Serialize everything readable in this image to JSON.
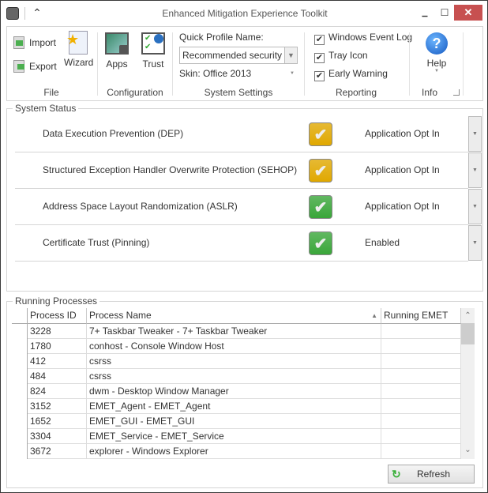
{
  "window": {
    "title": "Enhanced Mitigation Experience Toolkit",
    "close": "✕",
    "minimize": "▁",
    "maximize": "☐",
    "collapse": "⌃"
  },
  "ribbon": {
    "file": {
      "import": "Import",
      "export": "Export",
      "wizard": "Wizard",
      "label": "File"
    },
    "configuration": {
      "apps": "Apps",
      "trust": "Trust",
      "label": "Configuration"
    },
    "system_settings": {
      "profile_label": "Quick Profile Name:",
      "profile_value": "Recommended security ...",
      "skin": "Skin: Office 2013",
      "label": "System Settings"
    },
    "reporting": {
      "items": [
        {
          "label": "Windows Event Log",
          "checked": true
        },
        {
          "label": "Tray Icon",
          "checked": true
        },
        {
          "label": "Early Warning",
          "checked": true
        }
      ],
      "label": "Reporting"
    },
    "info": {
      "help": "Help",
      "label": "Info"
    }
  },
  "system_status": {
    "title": "System Status",
    "rows": [
      {
        "label": "Data Execution Prevention (DEP)",
        "status": "Application Opt In",
        "color": "#e0a800"
      },
      {
        "label": "Structured Exception Handler Overwrite Protection (SEHOP)",
        "status": "Application Opt In",
        "color": "#e0a800"
      },
      {
        "label": "Address Space Layout Randomization (ASLR)",
        "status": "Application Opt In",
        "color": "#3aa63a"
      },
      {
        "label": "Certificate Trust (Pinning)",
        "status": "Enabled",
        "color": "#3aa63a"
      }
    ]
  },
  "processes": {
    "title": "Running Processes",
    "columns": [
      "Process ID",
      "Process Name",
      "Running EMET"
    ],
    "rows": [
      [
        "3228",
        "7+ Taskbar Tweaker - 7+ Taskbar Tweaker",
        ""
      ],
      [
        "1780",
        "conhost - Console Window Host",
        ""
      ],
      [
        "412",
        "csrss",
        ""
      ],
      [
        "484",
        "csrss",
        ""
      ],
      [
        "824",
        "dwm - Desktop Window Manager",
        ""
      ],
      [
        "3152",
        "EMET_Agent - EMET_Agent",
        ""
      ],
      [
        "1652",
        "EMET_GUI - EMET_GUI",
        ""
      ],
      [
        "3304",
        "EMET_Service - EMET_Service",
        ""
      ],
      [
        "3672",
        "explorer - Windows Explorer",
        ""
      ]
    ],
    "refresh": "Refresh"
  }
}
